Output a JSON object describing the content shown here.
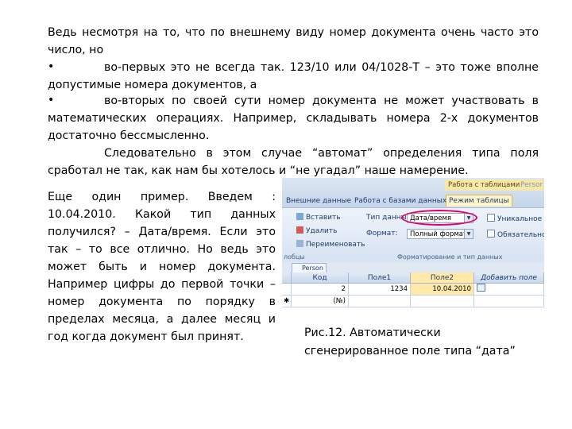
{
  "intro": {
    "line1": "Ведь несмотря на то, что по внешнему виду номер документа очень часто  это",
    "line2": "число, но",
    "bullet_symbol": "•",
    "b1_line1": "во-первых это не всегда так.   123/10 или 04/1028-Т – это тоже вполне",
    "b1_line2": "допустимые номера документов, а",
    "b2_line1": "во-вторых  по  своей  сути  номер  документа  не  может  участвовать  в",
    "b2_line2": "математических  операциях.  Например,  складывать  номера  2-х  документов",
    "b2_line3": "достаточно бессмысленно.",
    "c_line1": "Следовательно  в  этом  случае  “автомат”  определения  типа  поля",
    "c_line2": "сработал не так, как нам бы хотелось и “не угадал” наше намерение."
  },
  "example": {
    "lines": [
      "Еще    один    пример.    Введем    :",
      "10.04.2010.      Какой   тип   данных",
      "получился?  –  Дата/время.  Если  это",
      "так  –  то  все  отлично.  Но  ведь  это",
      "может  быть  и  номер  документа.",
      "Например цифры до первой точки –",
      "номер   документа   по   порядку   в",
      "пределах  месяца,  а  далее  месяц  и",
      "год когда документ был принят."
    ]
  },
  "screenshot": {
    "ctx_title": "Работа с таблицами",
    "ctx_title_right": "Persor",
    "tabs": [
      "Внешние данные",
      "Работа с базами данных",
      "Режим таблицы"
    ],
    "btn_insert": "Вставить",
    "btn_delete": "Удалить",
    "btn_rename": "Переименовать",
    "lbl_datatype": "Тип данных:",
    "val_datatype": "Дата/время",
    "lbl_format": "Формат:",
    "val_format": "Полный формат",
    "chk_unique": "Уникальное",
    "chk_required": "Обязательное",
    "group_fields": "лобцы",
    "group_format": "Форматирование и тип данных",
    "object_tab": "Person",
    "headers": [
      "Код",
      "Поле1",
      "Поле2",
      "Добавить поле"
    ],
    "row1": [
      "2",
      "1234",
      "10.04.2010"
    ],
    "row2_new": "(№)",
    "selector_star": "✱"
  },
  "caption": {
    "line1": "Рис.12. Автоматически",
    "line2": "сгенерированное поле типа “дата”"
  },
  "colors": {
    "highlight": "#e0006e",
    "context_tab": "#f7e7a8"
  }
}
